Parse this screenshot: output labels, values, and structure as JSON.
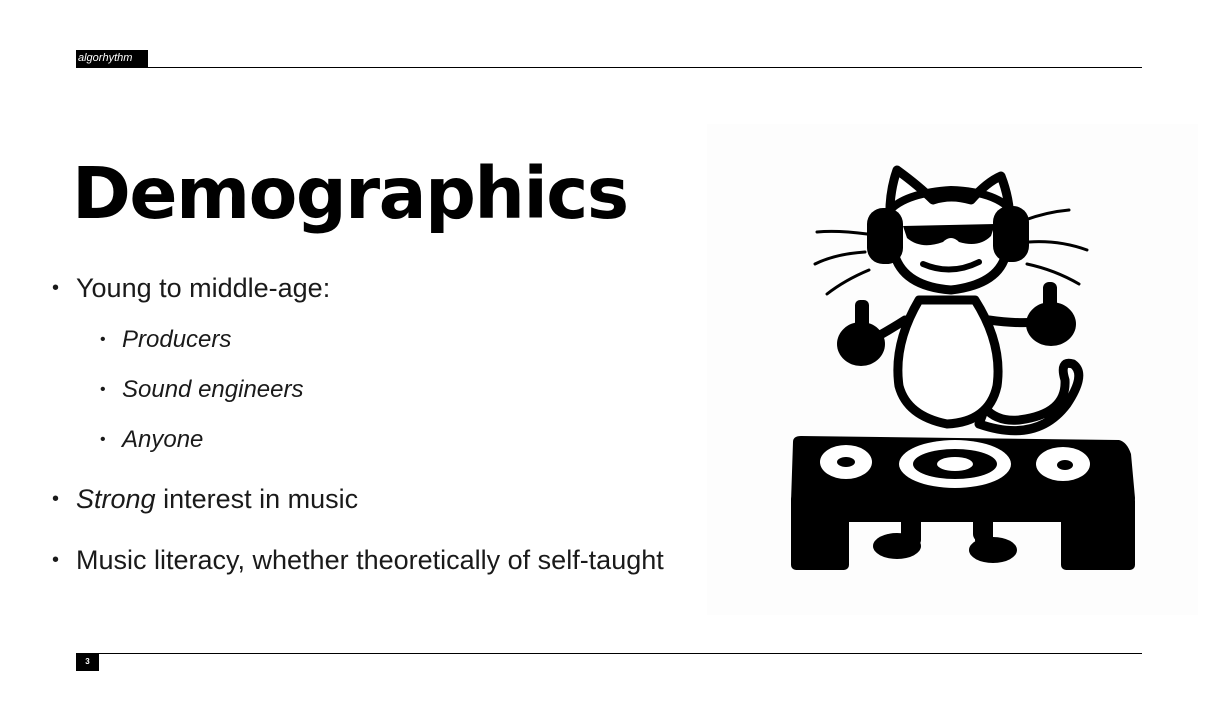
{
  "header": {
    "brand": "algorhythm"
  },
  "slide": {
    "title": "Demographics",
    "bullets": [
      {
        "text": "Young to middle-age:"
      },
      {
        "text": "Producers"
      },
      {
        "text": "Sound engineers"
      },
      {
        "text": "Anyone"
      },
      {
        "emphasis": "Strong",
        "text": " interest in music"
      },
      {
        "text": "Music literacy, whether theoretically of self-taught"
      }
    ]
  },
  "footer": {
    "page_number": "3"
  },
  "illustration": {
    "icon": "dj-cat-illustration"
  }
}
